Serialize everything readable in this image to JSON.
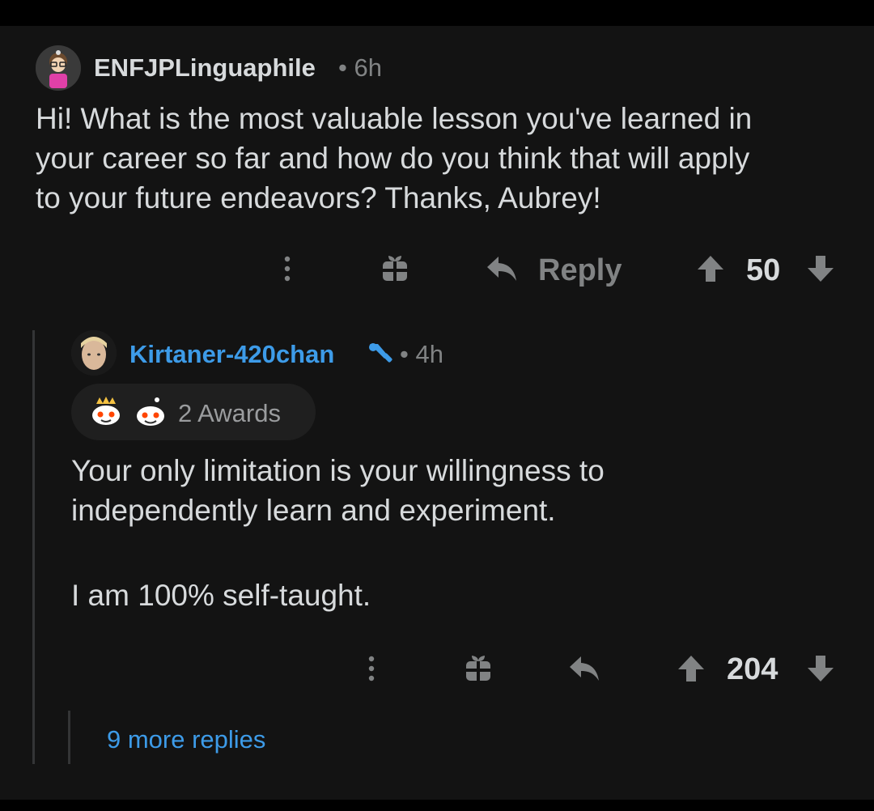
{
  "comment": {
    "author": "ENFJPLinguaphile",
    "age": "6h",
    "text_lines": [
      "Hi! What is the most valuable lesson you've  learned in",
      "your career so far and how do you think that will apply",
      "to your future endeavors? Thanks, Aubrey!"
    ],
    "reply_label": "Reply",
    "score": "50"
  },
  "reply": {
    "author": "Kirtaner-420chan",
    "age": "4h",
    "awards_label": "2 Awards",
    "paragraph1_lines": [
      "Your only limitation is your willingness to",
      "independently learn and experiment."
    ],
    "paragraph2": "I am 100% self-taught.",
    "score": "204"
  },
  "more_replies": "9 more replies",
  "colors": {
    "background": "#131313",
    "mod_username": "#3d9be8",
    "link": "#3d9be8",
    "muted": "#818384",
    "text": "#d7dadc"
  },
  "icons": {
    "overflow": "vertical-dots-icon",
    "award": "gift-icon",
    "reply": "reply-arrow-icon",
    "upvote": "upvote-arrow-icon",
    "downvote": "downvote-arrow-icon",
    "moderator": "mod-shield-icon"
  }
}
